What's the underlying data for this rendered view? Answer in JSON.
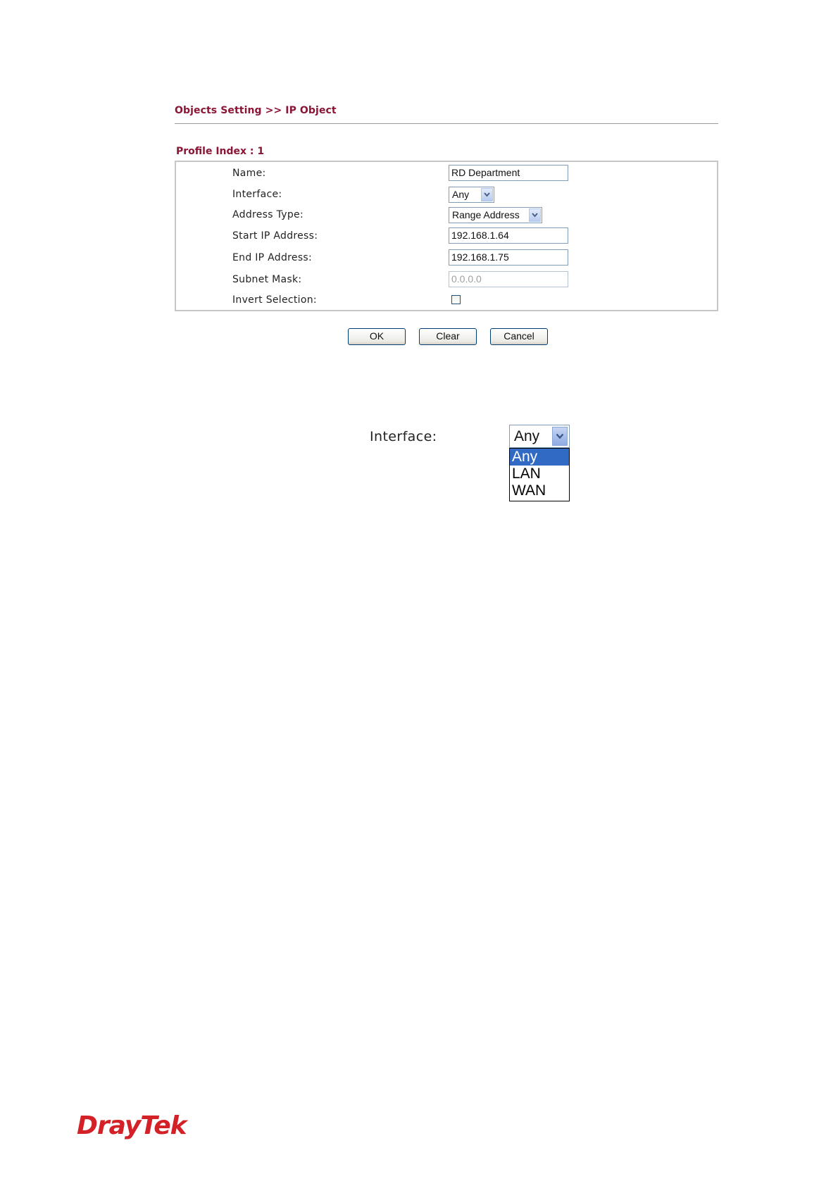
{
  "header": {
    "breadcrumb": "Objects Setting >> IP Object"
  },
  "profile": {
    "title": "Profile Index : 1"
  },
  "form": {
    "name": {
      "label": "Name:",
      "value": "RD Department"
    },
    "interface": {
      "label": "Interface:",
      "value": "Any"
    },
    "address_type": {
      "label": "Address Type:",
      "value": "Range Address"
    },
    "start_ip": {
      "label": "Start IP Address:",
      "value": "192.168.1.64"
    },
    "end_ip": {
      "label": "End IP Address:",
      "value": "192.168.1.75"
    },
    "subnet_mask": {
      "label": "Subnet Mask:",
      "value": "0.0.0.0"
    },
    "invert_selection": {
      "label": "Invert Selection:",
      "checked": false
    }
  },
  "buttons": {
    "ok": "OK",
    "clear": "Clear",
    "cancel": "Cancel"
  },
  "zoom_dropdown": {
    "label": "Interface:",
    "selected": "Any",
    "options": [
      "Any",
      "LAN",
      "WAN"
    ]
  },
  "footer": {
    "logo_text": "DrayTek"
  },
  "colors": {
    "heading": "#8b1535",
    "selection": "#316ac5",
    "logo": "#d42027"
  },
  "icons": {
    "dropdown": "chevron-down-icon"
  }
}
